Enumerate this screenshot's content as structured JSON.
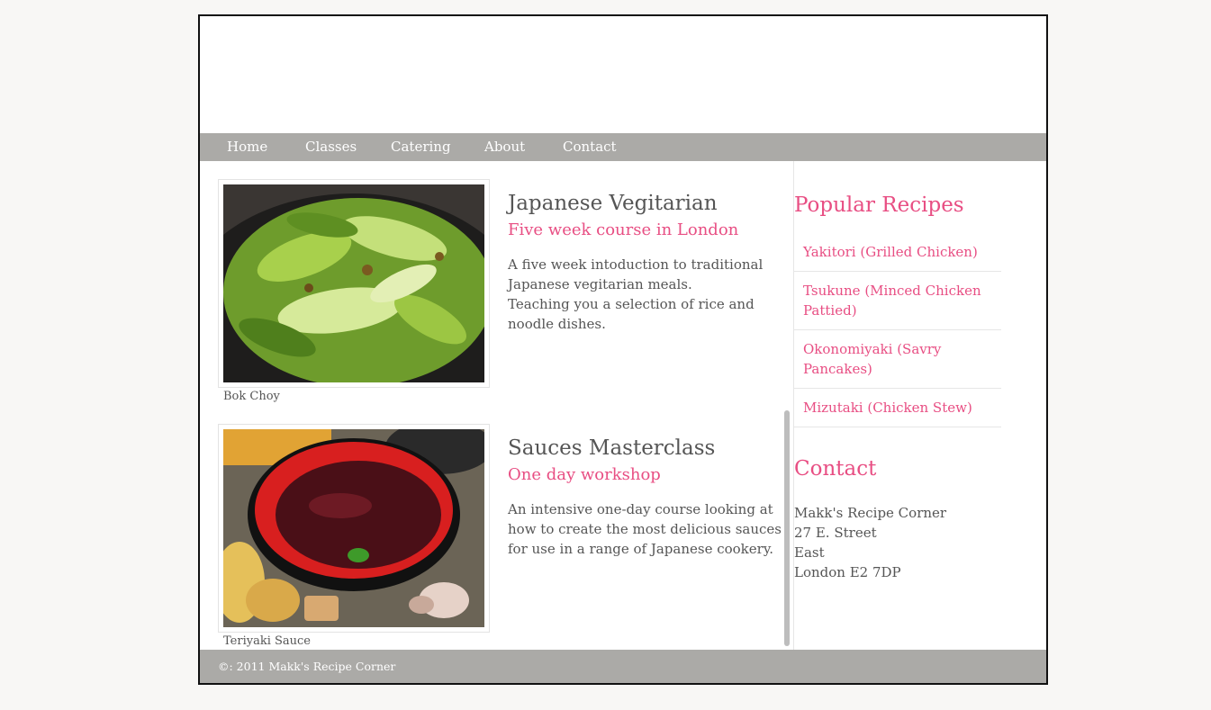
{
  "nav": {
    "items": [
      {
        "label": "Home"
      },
      {
        "label": "Classes"
      },
      {
        "label": "Catering"
      },
      {
        "label": "About"
      },
      {
        "label": "Contact"
      }
    ]
  },
  "courses": [
    {
      "image_caption": "Bok Choy",
      "title": "Japanese Vegitarian",
      "subtitle": "Five week course in London",
      "description": [
        "A five week intoduction to traditional Japanese vegitarian meals.",
        "Teaching you a selection of rice and noodle dishes."
      ]
    },
    {
      "image_caption": "Teriyaki Sauce",
      "title": "Sauces Masterclass",
      "subtitle": "One day workshop",
      "description": [
        "An intensive one-day course looking at how to create the most delicious sauces for use in a range of Japanese cookery."
      ]
    }
  ],
  "sidebar": {
    "popular_heading": "Popular Recipes",
    "recipes": [
      {
        "label": "Yakitori (Grilled Chicken)"
      },
      {
        "label": "Tsukune (Minced Chicken Pattied)"
      },
      {
        "label": "Okonomiyaki (Savry Pancakes)"
      },
      {
        "label": "Mizutaki (Chicken Stew)"
      }
    ],
    "contact_heading": "Contact",
    "address": [
      "Makk's Recipe Corner",
      "27 E. Street",
      "East",
      "London E2 7DP"
    ]
  },
  "footer": {
    "text": "©: 2011 Makk's Recipe Corner"
  },
  "colors": {
    "accent": "#e84e83",
    "nav_bg": "#abaaa7",
    "text": "#555555"
  }
}
